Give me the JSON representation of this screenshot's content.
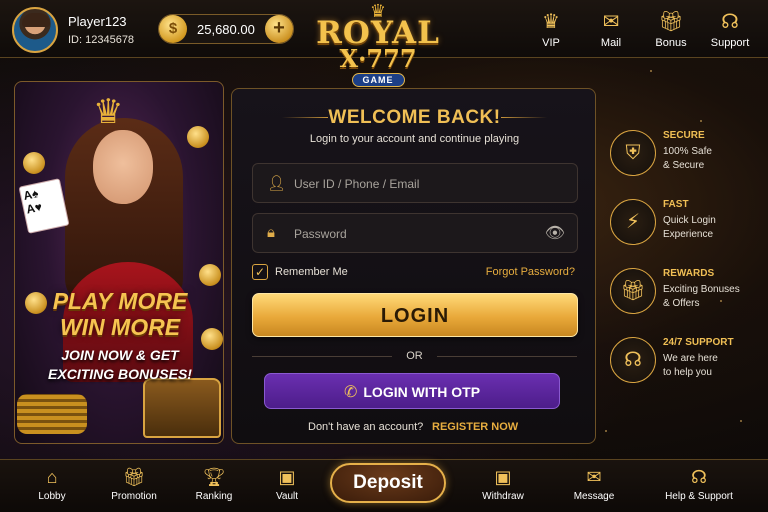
{
  "colors": {
    "gold": "#f0bf55",
    "purple": "#5a24a0",
    "background": "#120d0b",
    "login_button": "#e9a93a"
  },
  "header": {
    "player_name": "Player123",
    "player_id": "ID: 12345678",
    "balance": "25,680.00",
    "logo": {
      "line1": "ROYAL",
      "line2": "X·777",
      "badge": "GAME"
    },
    "nav": [
      {
        "label": "VIP",
        "icon": "crown-icon"
      },
      {
        "label": "Mail",
        "icon": "mail-icon"
      },
      {
        "label": "Bonus",
        "icon": "gift-icon"
      },
      {
        "label": "Support",
        "icon": "headset-icon"
      }
    ]
  },
  "promo": {
    "title_line1": "PLAY MORE",
    "title_line2": "WIN MORE",
    "sub_line1": "JOIN NOW & GET",
    "sub_line2": "EXCITING BONUSES!"
  },
  "login": {
    "title": "WELCOME BACK!",
    "subtitle": "Login to your account and continue playing",
    "user_placeholder": "User ID / Phone / Email",
    "password_placeholder": "Password",
    "remember_label": "Remember Me",
    "remember_checked": true,
    "forgot_label": "Forgot Password?",
    "login_label": "LOGIN",
    "or_label": "OR",
    "otp_label": "LOGIN WITH OTP",
    "register_question": "Don't have an account?",
    "register_label": "REGISTER NOW"
  },
  "features": [
    {
      "title": "SECURE",
      "line1": "100% Safe",
      "line2": "& Secure",
      "icon": "shield-check-icon"
    },
    {
      "title": "FAST",
      "line1": "Quick Login",
      "line2": "Experience",
      "icon": "lightning-icon"
    },
    {
      "title": "REWARDS",
      "line1": "Exciting Bonuses",
      "line2": "& Offers",
      "icon": "gift-icon"
    },
    {
      "title": "24/7 SUPPORT",
      "line1": "We are here",
      "line2": "to help you",
      "icon": "headset-icon"
    }
  ],
  "bottom_nav": [
    {
      "label": "Lobby",
      "icon": "home-icon"
    },
    {
      "label": "Promotion",
      "icon": "gift-icon"
    },
    {
      "label": "Ranking",
      "icon": "trophy-icon"
    },
    {
      "label": "Vault",
      "icon": "wallet-icon"
    },
    {
      "label": "Withdraw",
      "icon": "wallet-out-icon"
    },
    {
      "label": "Message",
      "icon": "envelope-icon"
    },
    {
      "label": "Help & Support",
      "icon": "headset-icon"
    }
  ],
  "deposit_label": "Deposit"
}
